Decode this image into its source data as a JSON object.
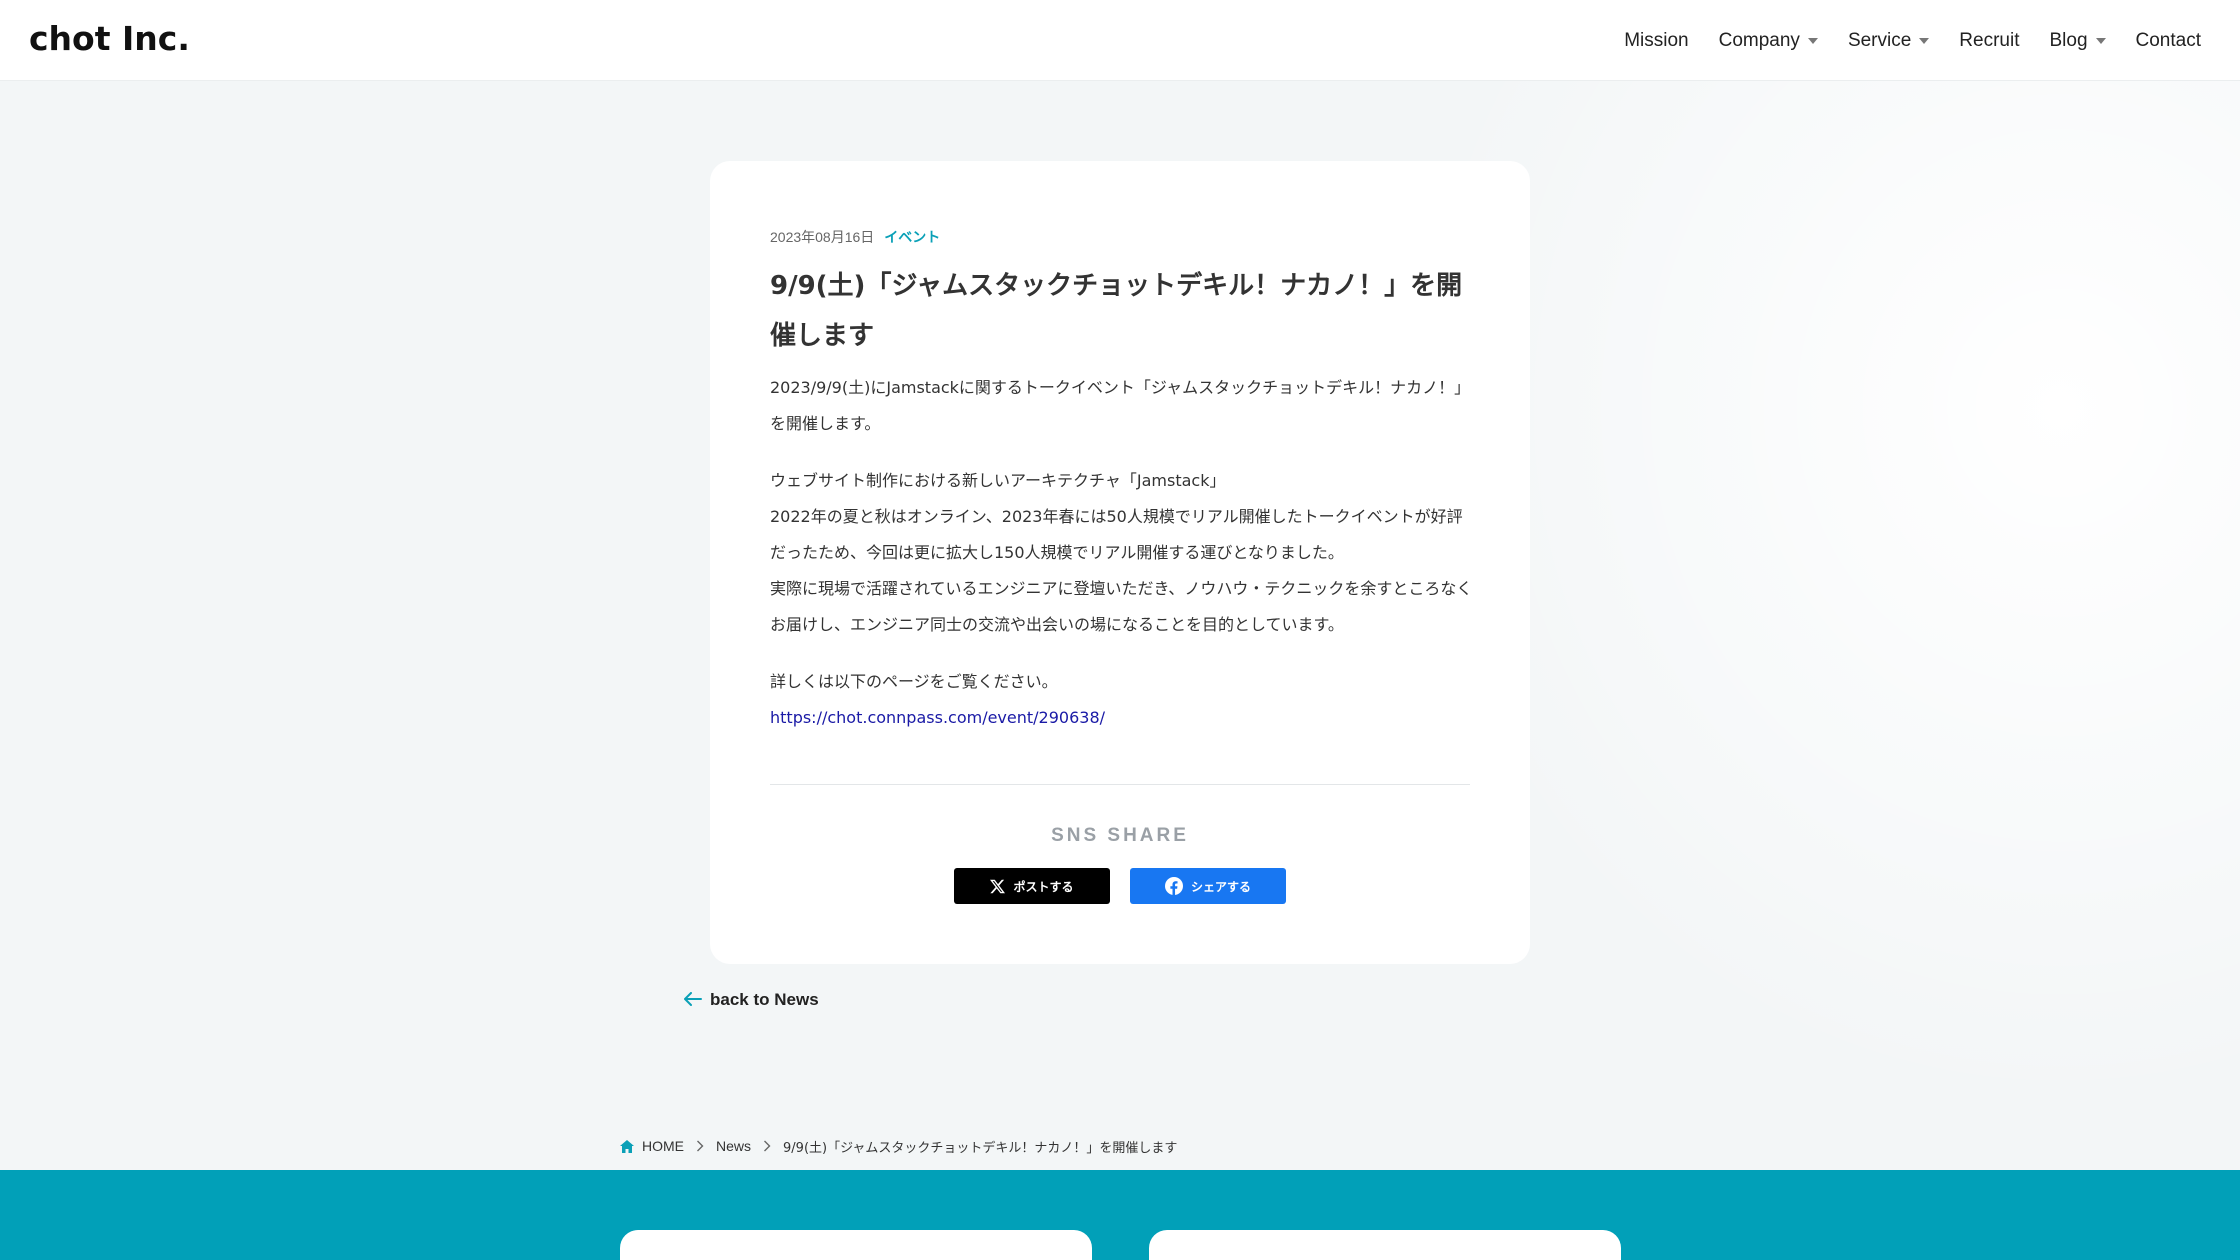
{
  "header": {
    "logo": "chot Inc.",
    "nav": [
      {
        "label": "Mission",
        "has_dropdown": false
      },
      {
        "label": "Company",
        "has_dropdown": true
      },
      {
        "label": "Service",
        "has_dropdown": true
      },
      {
        "label": "Recruit",
        "has_dropdown": false
      },
      {
        "label": "Blog",
        "has_dropdown": true
      },
      {
        "label": "Contact",
        "has_dropdown": false
      }
    ]
  },
  "article": {
    "date": "2023年08月16日",
    "category": "イベント",
    "title": "9/9(土)「ジャムスタックチョットデキル！ナカノ！」を開催します",
    "paragraphs": [
      "2023/9/9(土)にJamstackに関するトークイベント「ジャムスタックチョットデキル！ナカノ！」を開催します。",
      "ウェブサイト制作における新しいアーキテクチャ「Jamstack」\n2022年の夏と秋はオンライン、2023年春には50人規模でリアル開催したトークイベントが好評だったため、今回は更に拡大し150人規模でリアル開催する運びとなりました。\n実際に現場で活躍されているエンジニアに登壇いただき、ノウハウ・テクニックを余すところなくお届けし、エンジニア同士の交流や出会いの場になることを目的としています。",
      "詳しくは以下のページをご覧ください。"
    ],
    "link": "https://chot.connpass.com/event/290638/"
  },
  "share": {
    "heading": "SNS SHARE",
    "x_label": "ポストする",
    "facebook_label": "シェアする"
  },
  "back": {
    "label": "back to News"
  },
  "breadcrumb": {
    "home": "HOME",
    "news": "News",
    "current": "9/9(土)「ジャムスタックチョットデキル！ナカノ！」を開催します"
  },
  "colors": {
    "accent": "#0aa0b7",
    "footer": "#01a0b8",
    "facebook": "#1877f2",
    "x": "#000000",
    "link": "#1a1aa6"
  },
  "icons": {
    "x_logo": "x-logo-icon",
    "facebook_logo": "facebook-icon",
    "back_arrow": "arrow-left-icon",
    "home": "home-icon",
    "separator": "chevron-right-icon",
    "dropdown": "caret-down-icon"
  }
}
